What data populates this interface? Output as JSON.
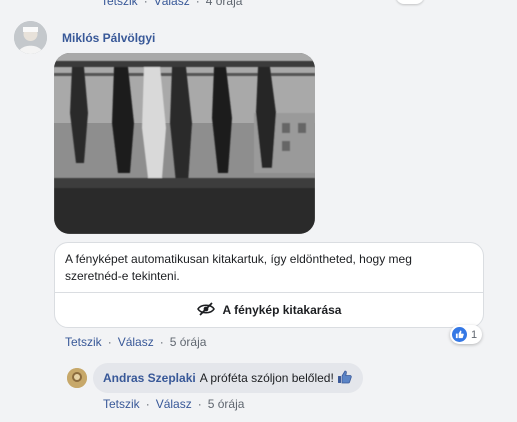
{
  "top_comment_actions": {
    "like": "Tetszik",
    "reply": "Válasz",
    "time": "4 órája"
  },
  "comment": {
    "author": "Miklós Pálvölgyi",
    "photo_icon": "hidden-photo",
    "cover_notice": "A fényképet automatikusan kitakartuk, így eldöntheted, hogy meg szeretnéd-e tekinteni.",
    "uncover_button": "A fénykép kitakarása",
    "uncover_icon": "eye-slash-icon",
    "reactions": {
      "icon": "like-icon",
      "count": "1"
    },
    "actions": {
      "like": "Tetszik",
      "reply": "Válasz",
      "time": "5 órája"
    }
  },
  "reply": {
    "author": "Andras Szeplaki",
    "text": "A próféta szóljon belőled!",
    "emoji": "thumbs-up-icon",
    "actions": {
      "like": "Tetszik",
      "reply": "Válasz",
      "time": "5 órája"
    }
  },
  "colors": {
    "link": "#385898",
    "meta": "#606770",
    "like_blue": "#3578e5",
    "bubble": "#e4e6eb",
    "background": "#f2f3f5"
  }
}
